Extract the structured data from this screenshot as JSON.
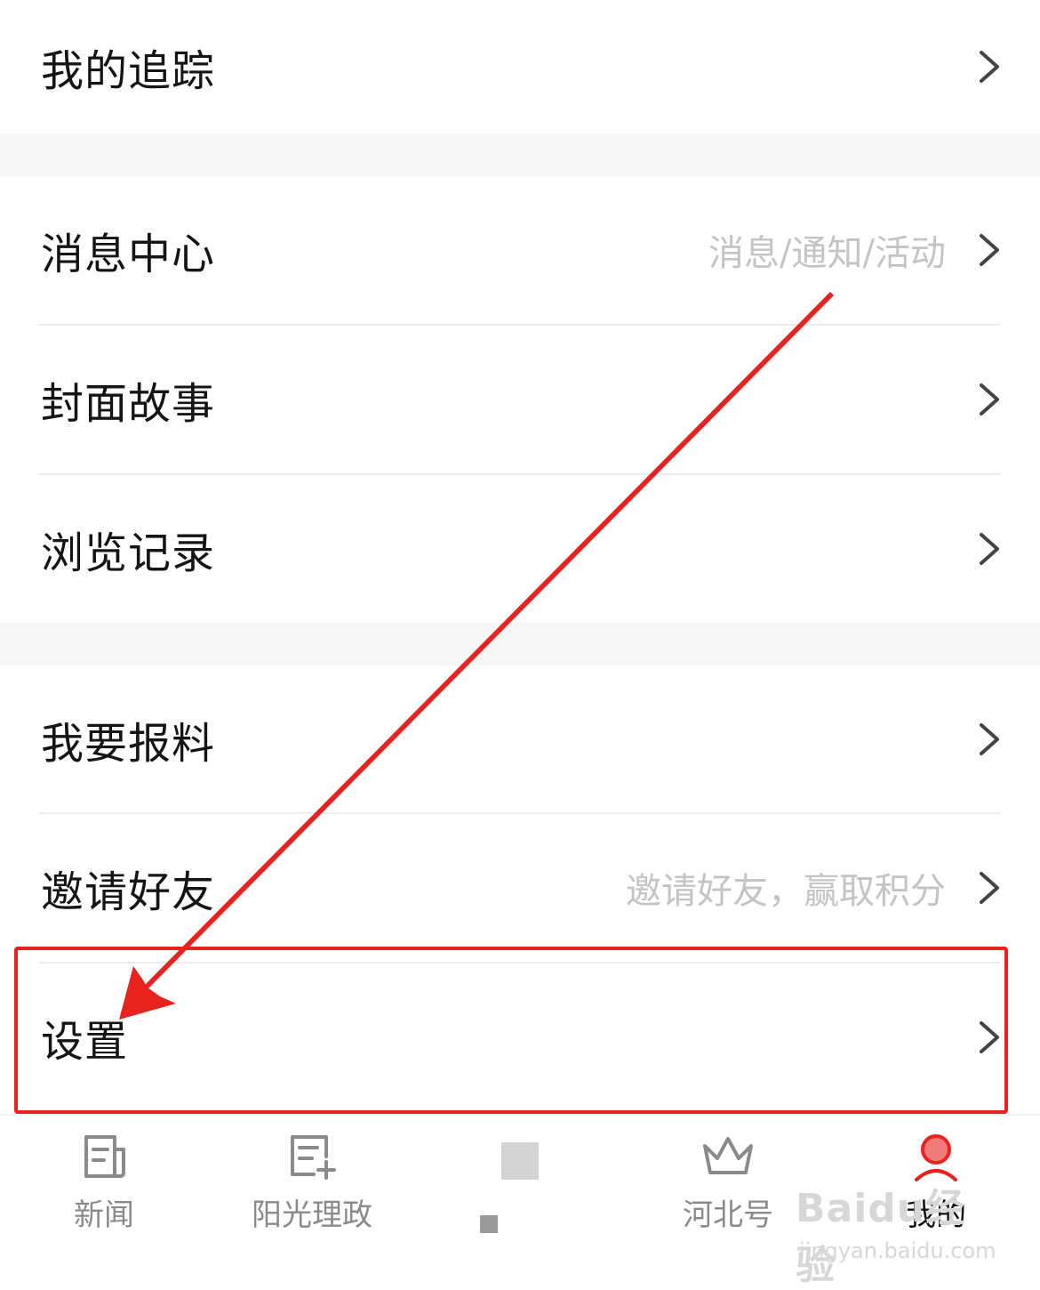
{
  "menu": {
    "tracking": {
      "label": "我的追踪"
    },
    "messages": {
      "label": "消息中心",
      "hint": "消息/通知/活动"
    },
    "cover_story": {
      "label": "封面故事"
    },
    "history": {
      "label": "浏览记录"
    },
    "report": {
      "label": "我要报料"
    },
    "invite": {
      "label": "邀请好友",
      "hint": "邀请好友，赢取积分"
    },
    "settings": {
      "label": "设置"
    }
  },
  "tabbar": {
    "tabs": [
      {
        "label": "新闻",
        "icon": "news-icon",
        "active": false
      },
      {
        "label": "阳光理政",
        "icon": "document-plus-icon",
        "active": false
      },
      {
        "label": "",
        "icon": "center-app-icon",
        "active": false
      },
      {
        "label": "河北号",
        "icon": "crown-icon",
        "active": false
      },
      {
        "label": "我的",
        "icon": "user-icon",
        "active": true
      }
    ]
  },
  "annotation": {
    "color": "#e8231f"
  },
  "watermark": {
    "logo": "Baidu经验",
    "url": "jingyan.baidu.com"
  },
  "colors": {
    "text": "#151515",
    "hint": "#c4c4c4",
    "divider": "#ececec",
    "tab_inactive": "#8a8a8a",
    "accent": "#e8231f"
  }
}
